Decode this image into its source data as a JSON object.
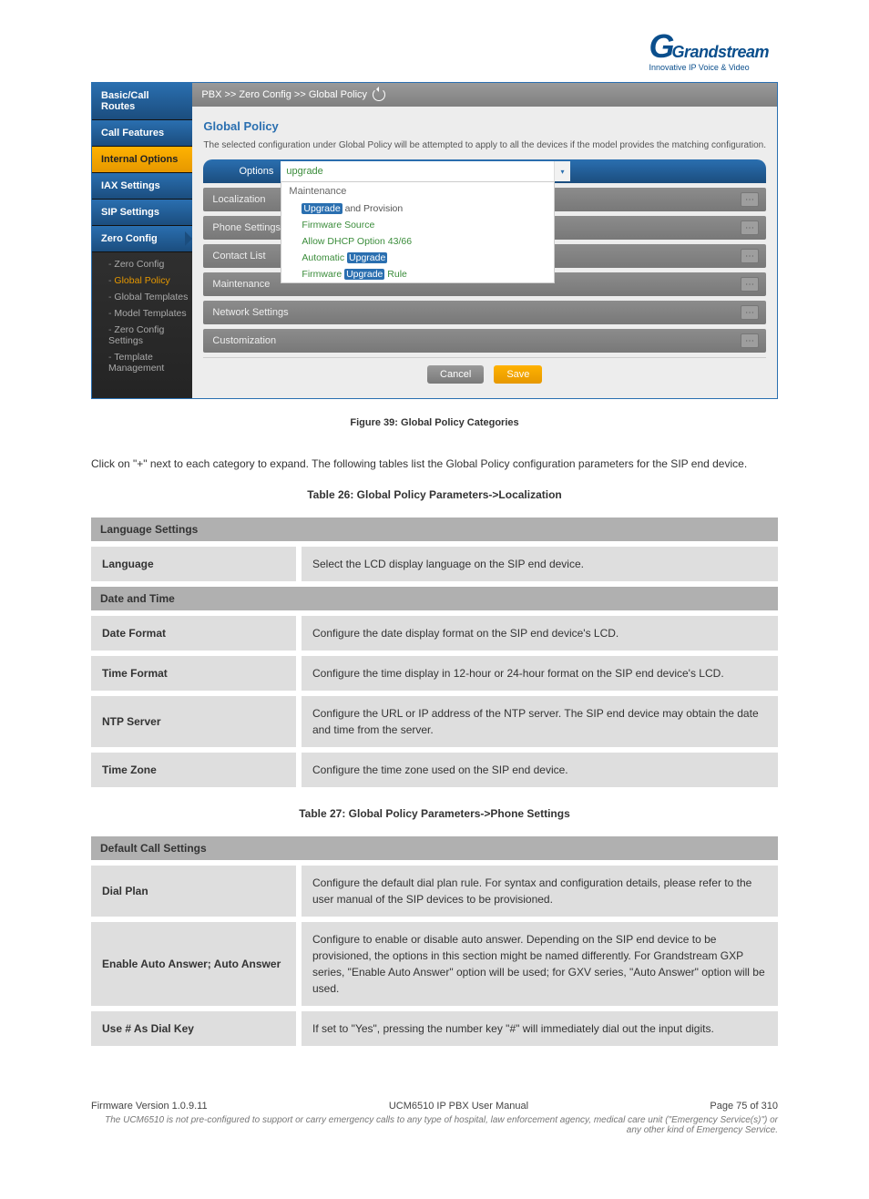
{
  "logo": {
    "brand": "Grandstream",
    "tagline": "Innovative IP Voice & Video"
  },
  "breadcrumb": "PBX >> Zero Config >> Global Policy",
  "pageTitle": "Global Policy",
  "pageDesc": "The selected configuration under Global Policy will be attempted to apply to all the devices if the model provides the matching configuration.",
  "sidebar": {
    "items": [
      {
        "label": "Basic/Call Routes",
        "style": "blue"
      },
      {
        "label": "Call Features",
        "style": "blue"
      },
      {
        "label": "Internal Options",
        "style": "yellow"
      },
      {
        "label": "IAX Settings",
        "style": "blue"
      },
      {
        "label": "SIP Settings",
        "style": "blue"
      },
      {
        "label": "Zero Config",
        "style": "active"
      }
    ],
    "subItems": [
      {
        "label": "Zero Config",
        "current": false
      },
      {
        "label": "Global Policy",
        "current": true
      },
      {
        "label": "Global Templates",
        "current": false
      },
      {
        "label": "Model Templates",
        "current": false
      },
      {
        "label": "Zero Config Settings",
        "current": false
      },
      {
        "label": "Template Management",
        "current": false
      }
    ]
  },
  "optionsLabel": "Options",
  "optionsValue": "upgrade",
  "ddMenu": {
    "category": "Maintenance",
    "opts": [
      {
        "prefix": "Upgrade",
        "suffix": " and Provision",
        "hl": true
      },
      {
        "prefix": "",
        "suffix": "Firmware Source",
        "hl": false
      },
      {
        "prefix": "",
        "suffix": "Allow DHCP Option 43/66",
        "hl": false
      },
      {
        "prefix": "Automatic ",
        "suffix": "",
        "tail": "Upgrade",
        "hl": true
      },
      {
        "prefix": "Firmware ",
        "suffix": " Rule",
        "tail": "Upgrade",
        "hl": true
      }
    ]
  },
  "sections": [
    {
      "label": "Localization"
    },
    {
      "label": "Phone Settings"
    },
    {
      "label": "Contact List"
    },
    {
      "label": "Maintenance"
    },
    {
      "label": "Network Settings"
    },
    {
      "label": "Customization"
    }
  ],
  "buttons": {
    "cancel": "Cancel",
    "save": "Save"
  },
  "figureCaption": "Figure 39: Global Policy Categories",
  "bodyPara": "Click on \"+\" next to each category to expand. The following tables list the Global Policy configuration parameters for the SIP end device.",
  "tableTitle": "Table 26: Global Policy Parameters->Localization",
  "table1": {
    "h1": "Language Settings",
    "rows1": [
      {
        "k": "Language",
        "v": "Select the LCD display language on the SIP end device."
      }
    ],
    "h2": "Date and Time",
    "rows2": [
      {
        "k": "Date Format",
        "v": "Configure the date display format on the SIP end device's LCD."
      },
      {
        "k": "Time Format",
        "v": "Configure the time display in 12-hour or 24-hour format on the SIP end device's LCD."
      },
      {
        "k": "NTP Server",
        "v": "Configure the URL or IP address of the NTP server. The SIP end device may obtain the date and time from the server."
      },
      {
        "k": "Time Zone",
        "v": "Configure the time zone used on the SIP end device."
      }
    ]
  },
  "tableTitle2": "Table 27: Global Policy Parameters->Phone Settings",
  "table2": {
    "h1": "Default Call Settings",
    "rows": [
      {
        "k": "Dial Plan",
        "v": "Configure the default dial plan rule. For syntax and configuration details, please refer to the user manual of the SIP devices to be provisioned."
      },
      {
        "k": "Enable Auto Answer; Auto Answer",
        "v": "Configure to enable or disable auto answer. Depending on the SIP end device to be provisioned, the options in this section might be named differently. For Grandstream GXP series, \"Enable Auto Answer\" option will be used; for GXV series, \"Auto Answer\" option will be used."
      },
      {
        "k": "Use # As Dial Key",
        "v": "If set to \"Yes\", pressing the number key \"#\" will immediately dial out the input digits."
      }
    ]
  },
  "footer": {
    "left": "Firmware Version 1.0.9.11",
    "center": "UCM6510 IP PBX User Manual",
    "right": "Page 75 of 310",
    "sub": "The UCM6510 is not pre-configured to support or carry emergency calls to any type of hospital, law enforcement agency, medical care unit (\"Emergency Service(s)\") or any other kind of Emergency Service."
  }
}
